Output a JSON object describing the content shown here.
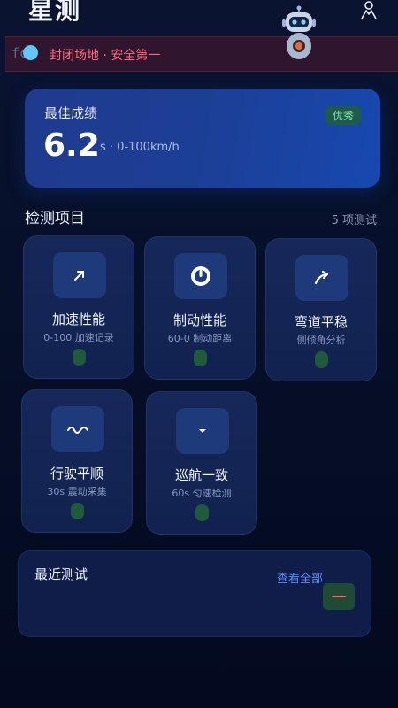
{
  "header": {
    "title": "星测"
  },
  "banner": {
    "prefix": "fc",
    "text": "封闭场地 · 安全第一"
  },
  "best": {
    "label": "最佳成绩",
    "value": "6.2",
    "unit": "s · 0-100km/h",
    "badge": "优秀"
  },
  "section": {
    "title": "检测项目",
    "count": "5 项测试"
  },
  "tests": [
    {
      "title": "加速性能",
      "sub": "0-100 加速记录",
      "icon": "arrow-up-right-icon"
    },
    {
      "title": "制动性能",
      "sub": "60-0 制动距离",
      "icon": "brake-disc-icon"
    },
    {
      "title": "弯道平稳",
      "sub": "侧倾角分析",
      "icon": "curve-arrow-icon"
    },
    {
      "title": "行驶平顺",
      "sub": "30s 震动采集",
      "icon": "wave-icon"
    },
    {
      "title": "巡航一致",
      "sub": "60s 匀速检测",
      "icon": "chevron-down-icon"
    }
  ],
  "recent": {
    "title": "最近测试",
    "link": "查看全部"
  },
  "colors": {
    "accent": "#5b8cff",
    "best_card": "#1c3f96",
    "badge": "#7fe3b0",
    "warning": "#ff6b78"
  }
}
